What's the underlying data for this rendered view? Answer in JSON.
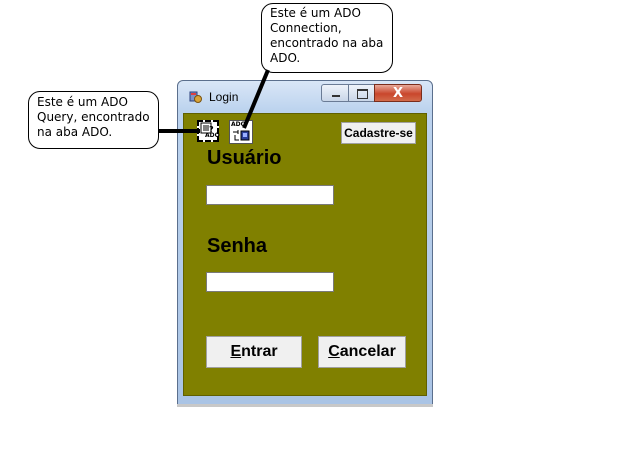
{
  "window": {
    "title": "Login",
    "buttons": {
      "close_glyph": "X"
    }
  },
  "form": {
    "cadastre_button": "Cadastre-se",
    "usuario_label": "Usuário",
    "usuario_value": "",
    "senha_label": "Senha",
    "senha_value": "",
    "entrar_first": "E",
    "entrar_rest": "ntrar",
    "cancelar_first": "C",
    "cancelar_rest": "ancelar"
  },
  "components": [
    {
      "icon": "ado-query-icon",
      "caption": "ADO"
    },
    {
      "icon": "ado-connection-icon",
      "caption": "ADO"
    }
  ],
  "callouts": {
    "connection": "Este é um ADO Connection, encontrado na aba ADO.",
    "query": "Este é um ADO Query, encontrado na aba ADO."
  },
  "colors": {
    "form_background": "#808000"
  }
}
